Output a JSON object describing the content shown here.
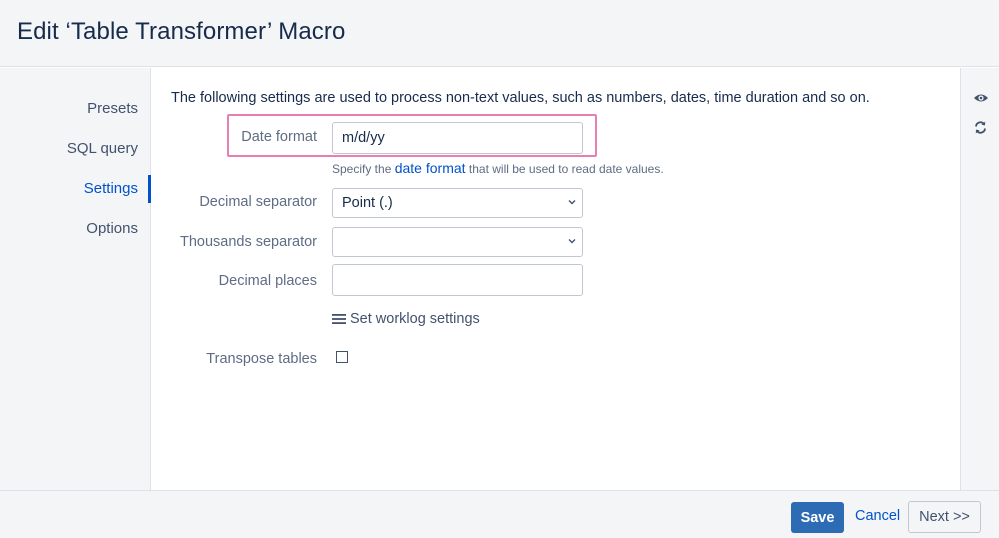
{
  "dialog": {
    "title": "Edit ‘Table Transformer’ Macro"
  },
  "sidebar": {
    "items": [
      {
        "label": "Presets"
      },
      {
        "label": "SQL query"
      },
      {
        "label": "Settings"
      },
      {
        "label": "Options"
      }
    ],
    "active": "Settings"
  },
  "main": {
    "intro": "The following settings are used to process non-text values, such as numbers, dates, time duration and so on.",
    "date_format": {
      "label": "Date format",
      "value": "m/d/yy",
      "help_prefix": "Specify the",
      "help_link": "date format",
      "help_suffix": "that will be used to read date values."
    },
    "decimal_separator": {
      "label": "Decimal separator",
      "value": "Point (.)"
    },
    "thousands_separator": {
      "label": "Thousands separator",
      "value": ""
    },
    "decimal_places": {
      "label": "Decimal places",
      "value": ""
    },
    "worklog": {
      "label": "Set worklog settings",
      "icon": "menu-icon"
    },
    "transpose": {
      "label": "Transpose tables",
      "checked": false
    }
  },
  "rightbar": {
    "icons": [
      "eye-icon",
      "refresh-icon"
    ]
  },
  "footer": {
    "save": "Save",
    "cancel": "Cancel",
    "next": "Next >>"
  },
  "colors": {
    "accent": "#0052cc",
    "save_bg": "#2d6cb4",
    "highlight": "#e77fb5"
  }
}
